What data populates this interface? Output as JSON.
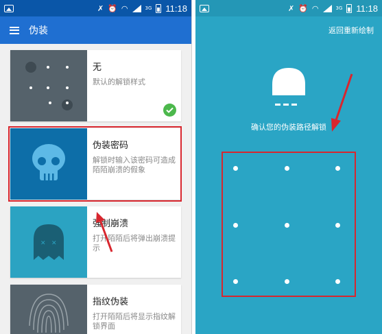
{
  "status_bar": {
    "time": "11:18",
    "network": "3G"
  },
  "left_screen": {
    "app_bar": {
      "title": "伪装"
    },
    "cards": [
      {
        "title": "无",
        "desc": "默认的解锁样式",
        "selected": true
      },
      {
        "title": "伪装密码",
        "desc": "解锁时输入该密码可造成陌陌崩溃的假象",
        "highlighted": true
      },
      {
        "title": "强制崩溃",
        "desc": "打开陌陌后将弹出崩溃提示"
      },
      {
        "title": "指纹伪装",
        "desc": "打开陌陌后将显示指纹解锁界面"
      }
    ]
  },
  "right_screen": {
    "reset_link": "返回重新绘制",
    "prompt": "确认您的伪装路径解锁",
    "pattern_grid": {
      "rows": 3,
      "cols": 3
    }
  },
  "colors": {
    "status_bar_left": "#0a56a8",
    "app_bar": "#1f6fd1",
    "right_background": "#2aa5c5",
    "highlight_box": "#d8262e",
    "check_badge": "#4cb84c"
  }
}
